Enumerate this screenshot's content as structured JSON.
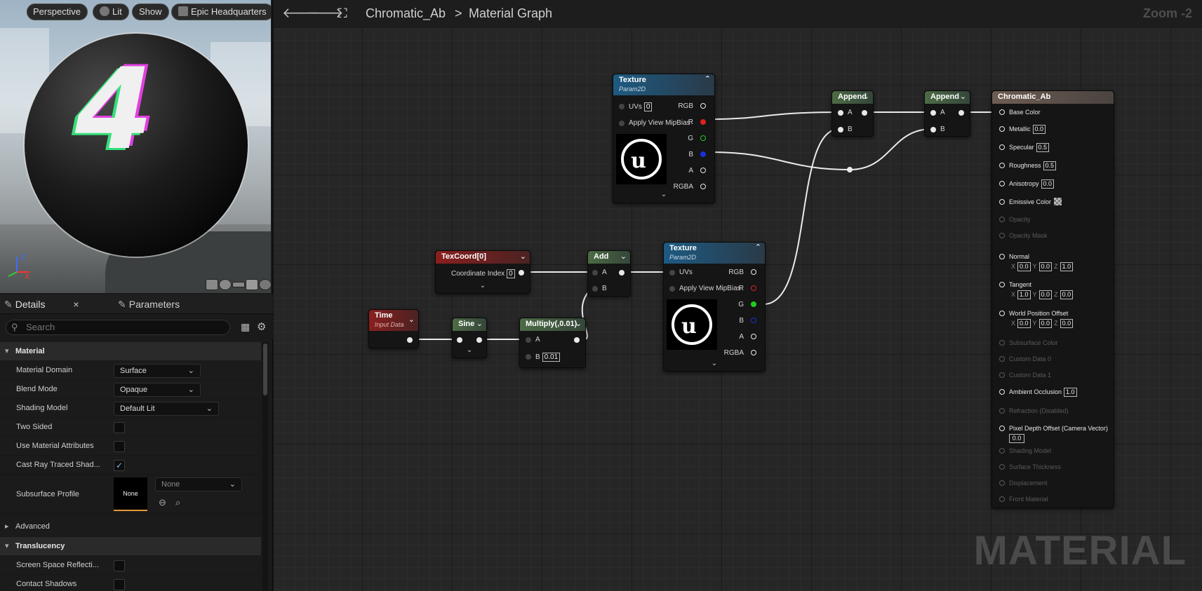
{
  "viewport": {
    "buttons": [
      "Perspective",
      "Lit",
      "Show",
      "Epic Headquarters"
    ],
    "axis_z": "Z",
    "axis_x": "X",
    "preview_number": "4"
  },
  "tabs": {
    "details": "Details",
    "parameters": "Parameters",
    "close": "×"
  },
  "search": {
    "placeholder": "Search"
  },
  "details": {
    "material_category": "Material",
    "rows": [
      {
        "label": "Material Domain",
        "value": "Surface"
      },
      {
        "label": "Blend Mode",
        "value": "Opaque"
      },
      {
        "label": "Shading Model",
        "value": "Default Lit"
      },
      {
        "label": "Two Sided"
      },
      {
        "label": "Use Material Attributes"
      },
      {
        "label": "Cast Ray Traced Shad...",
        "check": "✓"
      },
      {
        "label": "Subsurface Profile",
        "value": "None",
        "thumb": "None"
      }
    ],
    "advanced": "Advanced",
    "translucency_category": "Translucency",
    "trans_rows": [
      {
        "label": "Screen Space Reflecti..."
      },
      {
        "label": "Contact Shadows"
      }
    ]
  },
  "graph": {
    "breadcrumb_root": "Chromatic_Ab",
    "breadcrumb_sep": ">",
    "breadcrumb_page": "Material Graph",
    "zoom": "Zoom -2",
    "watermark": "MATERIAL"
  },
  "nodes": {
    "tex1": {
      "title": "Texture",
      "sub": "Param2D",
      "uvs": "UVs",
      "uvs_val": "0",
      "mip": "Apply View MipBias",
      "outs": [
        "RGB",
        "R",
        "G",
        "B",
        "A",
        "RGBA"
      ]
    },
    "tex2": {
      "title": "Texture",
      "sub": "Param2D",
      "uvs": "UVs",
      "mip": "Apply View MipBias",
      "outs": [
        "RGB",
        "R",
        "G",
        "B",
        "A",
        "RGBA"
      ]
    },
    "append1": {
      "title": "Append",
      "a": "A",
      "b": "B"
    },
    "append2": {
      "title": "Append",
      "a": "A",
      "b": "B"
    },
    "texcoord": {
      "title": "TexCoord[0]",
      "index_label": "Coordinate Index",
      "index_val": "0"
    },
    "add": {
      "title": "Add",
      "a": "A",
      "b": "B"
    },
    "time": {
      "title": "Time",
      "sub": "Input Data"
    },
    "sine": {
      "title": "Sine"
    },
    "multiply": {
      "title": "Multiply(,0.01)",
      "a": "A",
      "b": "B",
      "b_val": "0.01"
    },
    "material": {
      "title": "Chromatic_Ab",
      "pins": [
        {
          "label": "Base Color"
        },
        {
          "label": "Metallic",
          "val": "0.0"
        },
        {
          "label": "Specular",
          "val": "0.5"
        },
        {
          "label": "Roughness",
          "val": "0.5"
        },
        {
          "label": "Anisotropy",
          "val": "0.0"
        },
        {
          "label": "Emissive Color"
        },
        {
          "label": "Opacity"
        },
        {
          "label": "Opacity Mask"
        },
        {
          "label": "Normal",
          "x": "0.0",
          "y": "0.0",
          "z": "1.0"
        },
        {
          "label": "Tangent",
          "x": "1.0",
          "y": "0.0",
          "z": "0.0"
        },
        {
          "label": "World Position Offset",
          "x": "0.0",
          "y": "0.0",
          "z": "0.0"
        },
        {
          "label": "Subsurface Color"
        },
        {
          "label": "Custom Data 0"
        },
        {
          "label": "Custom Data 1"
        },
        {
          "label": "Ambient Occlusion",
          "val": "1.0"
        },
        {
          "label": "Refraction (Disabled)"
        },
        {
          "label": "Pixel Depth Offset (Camera Vector)",
          "val": "0.0"
        },
        {
          "label": "Shading Model"
        },
        {
          "label": "Surface Thickness"
        },
        {
          "label": "Displacement"
        },
        {
          "label": "Front Material"
        }
      ],
      "axis_x": "X",
      "axis_y": "Y",
      "axis_z": "Z"
    }
  },
  "colors": {
    "texture_header": "#1d5a82",
    "math_header": "#4d6b45",
    "input_header": "#8a1f1f",
    "result_header": "#6e5d52",
    "pin_red": "#e02020",
    "pin_green": "#22cc22",
    "pin_blue": "#1a2fd8"
  }
}
